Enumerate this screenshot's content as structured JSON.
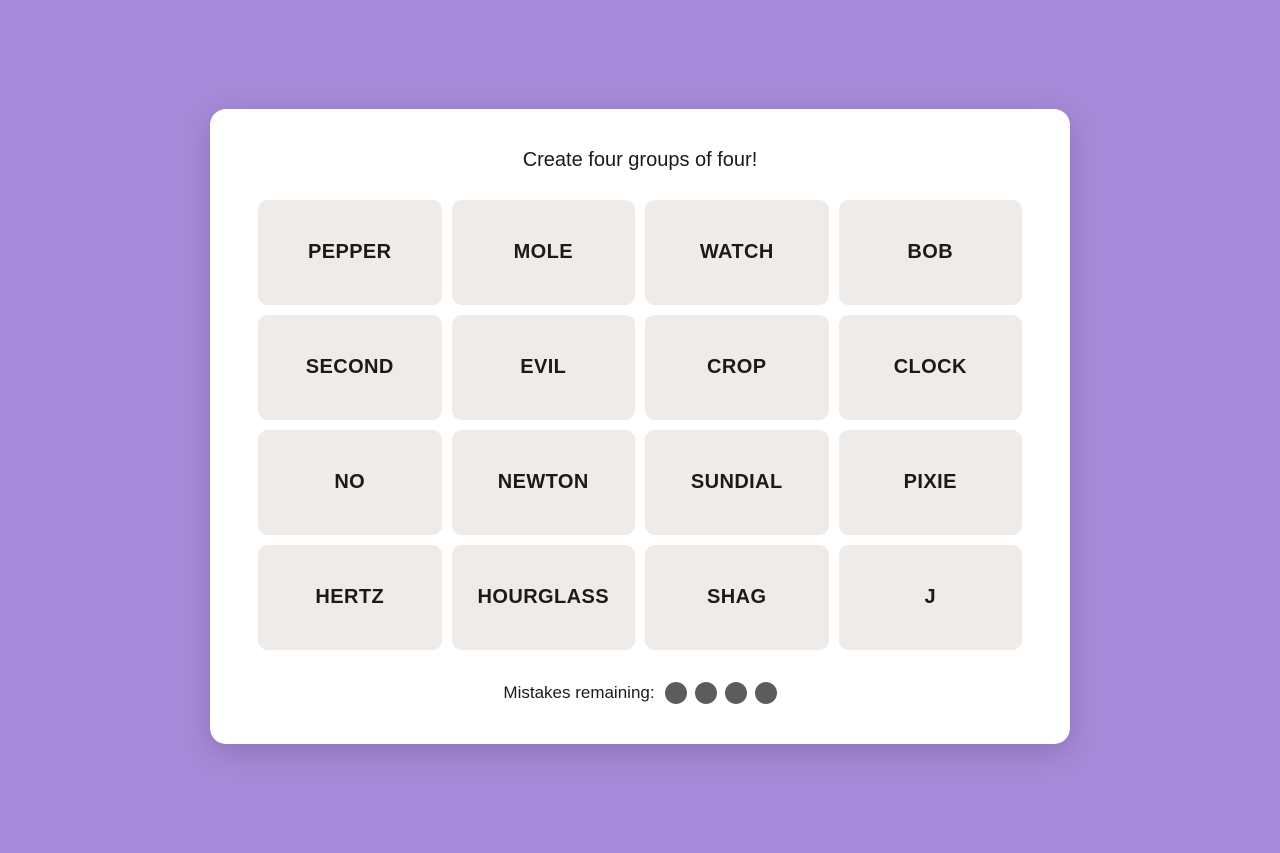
{
  "game": {
    "title": "Create four groups of four!",
    "tiles": [
      {
        "label": "PEPPER"
      },
      {
        "label": "MOLE"
      },
      {
        "label": "WATCH"
      },
      {
        "label": "BOB"
      },
      {
        "label": "SECOND"
      },
      {
        "label": "EVIL"
      },
      {
        "label": "CROP"
      },
      {
        "label": "CLOCK"
      },
      {
        "label": "NO"
      },
      {
        "label": "NEWTON"
      },
      {
        "label": "SUNDIAL"
      },
      {
        "label": "PIXIE"
      },
      {
        "label": "HERTZ"
      },
      {
        "label": "HOURGLASS"
      },
      {
        "label": "SHAG"
      },
      {
        "label": "J"
      }
    ],
    "mistakes": {
      "label": "Mistakes remaining:",
      "remaining": 4
    }
  }
}
